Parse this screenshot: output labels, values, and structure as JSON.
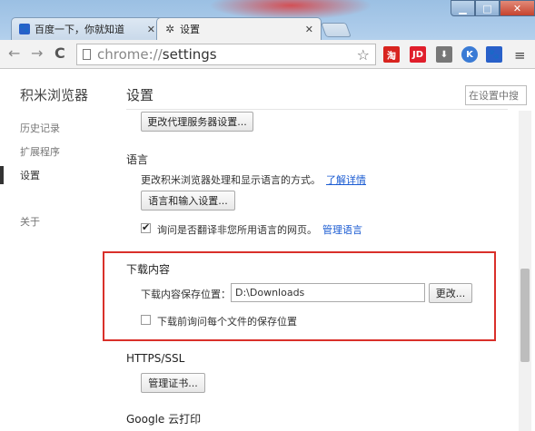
{
  "window": {
    "minimize_symbol": "▁",
    "maximize_symbol": "□",
    "close_symbol": "✕"
  },
  "tabs": [
    {
      "title": "百度一下，你就知道",
      "icon": "paw-icon",
      "close": "✕"
    },
    {
      "title": "设置",
      "icon": "gear-icon",
      "close": "✕"
    }
  ],
  "toolbar": {
    "back_symbol": "←",
    "forward_symbol": "→",
    "reload_symbol": "C",
    "url_scheme": "chrome://",
    "url_path": "settings",
    "star_symbol": "☆",
    "menu_symbol": "≡",
    "extensions": [
      {
        "name": "taobao-extension-icon",
        "label": "淘",
        "color": "#d8241f"
      },
      {
        "name": "jd-extension-icon",
        "label": "JD",
        "color": "#e01e2b"
      },
      {
        "name": "download-extension-icon",
        "label": "⬇",
        "color": "#777777"
      },
      {
        "name": "k-extension-icon",
        "label": "K",
        "color": "#3a7bd5"
      },
      {
        "name": "baidu-paw-extension-icon",
        "label": "🐾",
        "color": "#2860c9"
      }
    ]
  },
  "sidebar": {
    "brand": "积米浏览器",
    "items": [
      {
        "label": "历史记录"
      },
      {
        "label": "扩展程序"
      },
      {
        "label": "设置",
        "active": true
      },
      {
        "label": "关于"
      }
    ]
  },
  "main": {
    "title": "设置",
    "search_placeholder": "在设置中搜",
    "proxy_button": "更改代理服务器设置...",
    "language": {
      "title": "语言",
      "description": "更改积米浏览器处理和显示语言的方式。",
      "learn_more": "了解详情",
      "input_button": "语言和输入设置...",
      "translate_checkbox": "询问是否翻译非您所用语言的网页。",
      "translate_checked": true,
      "manage_languages": "管理语言"
    },
    "downloads": {
      "title": "下载内容",
      "location_label": "下载内容保存位置：",
      "location_value": "D:\\Downloads",
      "change_button": "更改...",
      "ask_checkbox": "下载前询问每个文件的保存位置",
      "ask_checked": false
    },
    "https": {
      "title": "HTTPS/SSL",
      "manage_button": "管理证书..."
    },
    "cloud_print": {
      "title": "Google 云打印"
    }
  },
  "colors": {
    "highlight_border": "#d9302a",
    "link": "#1a5bd2"
  }
}
